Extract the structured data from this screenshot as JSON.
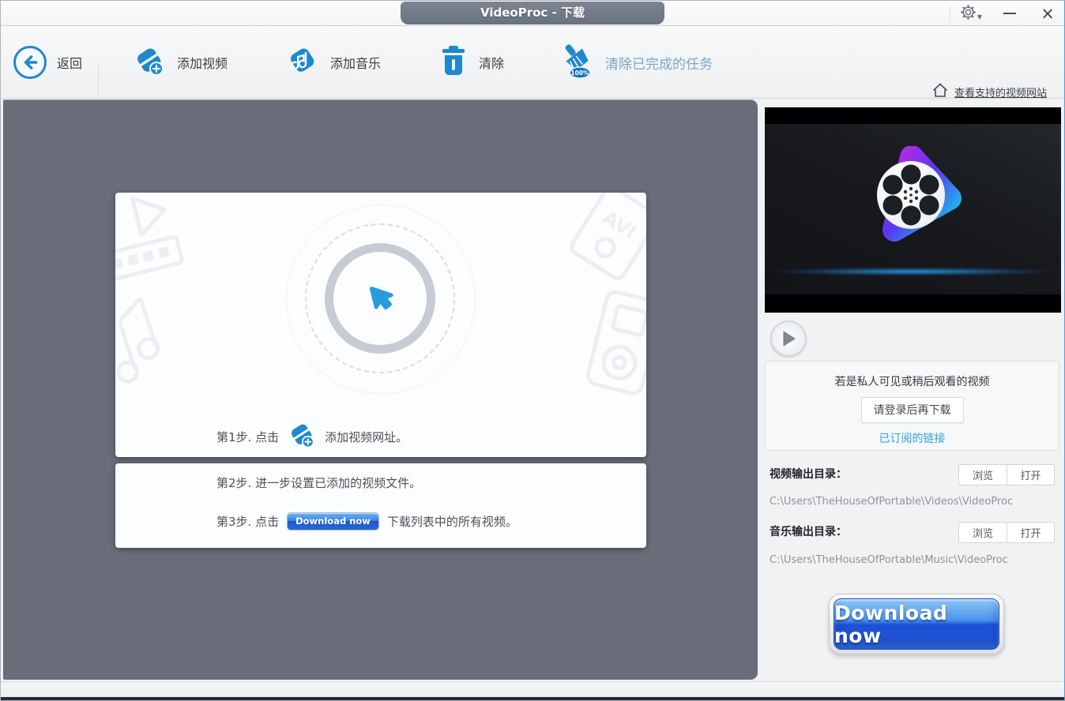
{
  "window": {
    "title": "VideoProc - 下载",
    "controls": {
      "close_glyph": "×"
    }
  },
  "toolbar": {
    "back": "返回",
    "add_video": "添加视频",
    "add_music": "添加音乐",
    "clear": "清除",
    "clear_finished": "清除已完成的任务",
    "supported_sites": "查看支持的视频网站"
  },
  "main": {
    "steps": {
      "s1_prefix": "第1步. 点击",
      "s1_suffix": "添加视频网址。",
      "s2": "第2步. 进一步设置已添加的视频文件。",
      "s3_prefix": "第3步. 点击",
      "s3_button": "Download now",
      "s3_suffix": "下载列表中的所有视频。"
    },
    "watermarks": {
      "avi": "AVI"
    }
  },
  "sidebar": {
    "login_notice": "若是私人可见或稍后观看的视频",
    "login_button": "请登录后再下载",
    "subscribed_link": "已订阅的链接",
    "video_dir_label": "视频输出目录：",
    "video_dir_path": "C:\\Users\\TheHouseOfPortable\\Videos\\VideoProc",
    "music_dir_label": "音乐输出目录：",
    "music_dir_path": "C:\\Users\\TheHouseOfPortable\\Music\\VideoProc",
    "browse_button": "浏览",
    "open_button": "打开",
    "download_button": "Download now",
    "broom_badge": "100%"
  },
  "colors": {
    "accent_blue": "#1e88d0",
    "link_blue": "#2aa4da",
    "toolbar_blue_text": "#7aa6ca",
    "panel_gray": "#686d79",
    "download_gradient_top": "#8ec7f5",
    "download_gradient_bottom": "#1b50d4"
  }
}
